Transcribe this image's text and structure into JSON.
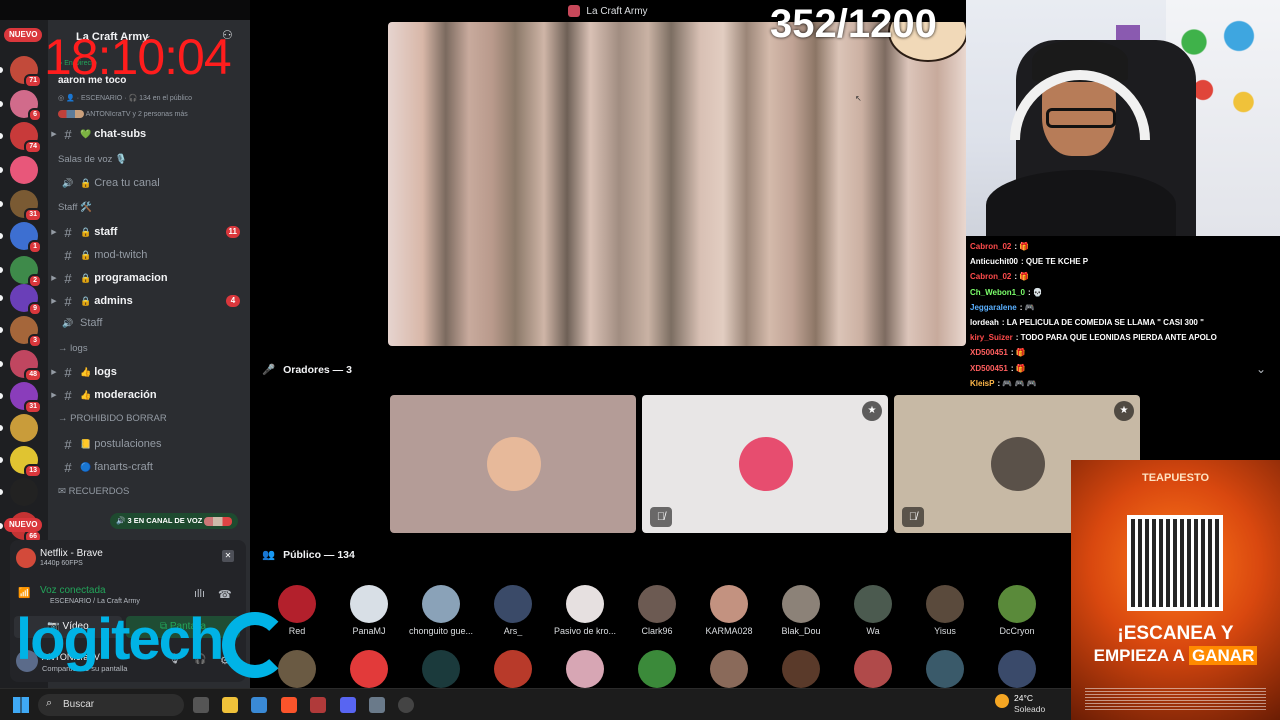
{
  "window": {
    "title": "La Craft Army"
  },
  "stream": {
    "timer": "18:10:04",
    "counter": "352/1200"
  },
  "rail": {
    "nuevo_top": "NUEVO",
    "nuevo_bottom": "NUEVO",
    "servers": [
      {
        "badge": "71",
        "color": "#c24a3a"
      },
      {
        "badge": "6",
        "color": "#d16b8b"
      },
      {
        "badge": "74",
        "color": "#c83a3a"
      },
      {
        "badge": "",
        "color": "#e8577a"
      },
      {
        "badge": "31",
        "color": "#7a5a33"
      },
      {
        "badge": "1",
        "color": "#3d6fd1"
      },
      {
        "badge": "2",
        "color": "#3e8a4a"
      },
      {
        "badge": "9",
        "color": "#6a3fb8"
      },
      {
        "badge": "3",
        "color": "#a5663a"
      },
      {
        "badge": "48",
        "color": "#c04660"
      },
      {
        "badge": "31",
        "color": "#8a3dbb"
      },
      {
        "badge": "",
        "color": "#c99c3a"
      },
      {
        "badge": "13",
        "color": "#e0c431"
      },
      {
        "badge": "",
        "color": "#222"
      },
      {
        "badge": "66",
        "color": "#c43333"
      }
    ]
  },
  "server": {
    "name": "La Craft Army",
    "live_label": "En Directo",
    "stage_title": "aaron me toco",
    "stage_meta": "ESCENARIO",
    "stage_listeners": "134 en el público",
    "stage_speakers": "ANTONIcraTV y 2 personas más"
  },
  "channels": [
    {
      "type": "text",
      "label": "chat-subs",
      "bold": true,
      "emoji": "💚",
      "caret": true
    },
    {
      "type": "category",
      "label": "Salas de voz 🎙️"
    },
    {
      "type": "voice",
      "label": "Crea tu canal",
      "lock": true
    },
    {
      "type": "category",
      "label": "Staff 🛠️"
    },
    {
      "type": "text",
      "label": "staff",
      "bold": true,
      "lock": true,
      "badge": "11",
      "caret": true
    },
    {
      "type": "text",
      "label": "mod-twitch",
      "lock": true
    },
    {
      "type": "text",
      "label": "programacion",
      "bold": true,
      "lock": true,
      "caret": true
    },
    {
      "type": "text",
      "label": "admins",
      "bold": true,
      "lock": true,
      "badge": "4",
      "caret": true
    },
    {
      "type": "voice",
      "label": "Staff",
      "lock": false
    },
    {
      "type": "category",
      "label": "→ logs"
    },
    {
      "type": "text",
      "label": "logs",
      "bold": true,
      "emoji": "👍",
      "caret": true
    },
    {
      "type": "text",
      "label": "moderación",
      "bold": true,
      "emoji": "👍",
      "caret": true
    },
    {
      "type": "category",
      "label": "→ PROHIBIDO BORRAR"
    },
    {
      "type": "text",
      "label": "postulaciones",
      "emoji": "📒"
    },
    {
      "type": "text",
      "label": "fanarts-craft",
      "emoji": "🔵"
    },
    {
      "type": "category",
      "label": "✉ RECUERDOS"
    }
  ],
  "voice_pill": "3 EN CANAL DE VOZ",
  "user_panel": {
    "activity_title": "Netflix - Brave",
    "activity_sub": "1440p 60FPS",
    "voice_status": "Voz conectada",
    "voice_channel": "ESCENARIO / La Craft Army",
    "video_btn": "Vídeo",
    "screen_btn": "Pantalla",
    "username": "ANTONIcraTV",
    "user_status": "Compartiendo su pantalla",
    "brand": "logitech"
  },
  "stage": {
    "speakers_header": "Oradores — 3",
    "audience_header": "Público — 134",
    "speakers": [
      {
        "bg": "#b49c97",
        "av": "#e7b99a"
      },
      {
        "bg": "#e8e6e6",
        "av": "#e74d6f"
      },
      {
        "bg": "#c7b9a5",
        "av": "#5a5149"
      }
    ],
    "audience_row1": [
      {
        "name": "Red",
        "color": "#b3202c"
      },
      {
        "name": "PanaMJ",
        "color": "#d8dfe6"
      },
      {
        "name": "chonguito gue...",
        "color": "#8aa2b8"
      },
      {
        "name": "Ars_",
        "color": "#3a4a68"
      },
      {
        "name": "Pasivo de kro...",
        "color": "#e6e0e0"
      },
      {
        "name": "Clark96",
        "color": "#6c5a52"
      },
      {
        "name": "KARMA028",
        "color": "#c39280"
      },
      {
        "name": "Blak_Dou",
        "color": "#8c8278"
      },
      {
        "name": "Wa",
        "color": "#4b5a4f"
      },
      {
        "name": "Yisus",
        "color": "#5a4a3c"
      },
      {
        "name": "DcCryon",
        "color": "#5a8a3a"
      }
    ],
    "audience_row2": [
      {
        "color": "#6a5a43"
      },
      {
        "color": "#e23a3a"
      },
      {
        "color": "#1b3a3c"
      },
      {
        "color": "#b83a2a"
      },
      {
        "color": "#d7a6b4"
      },
      {
        "color": "#3b8a3a"
      },
      {
        "color": "#8a6a5a"
      },
      {
        "color": "#5a3a2a"
      },
      {
        "color": "#b04a4a"
      },
      {
        "color": "#3a5a6a"
      },
      {
        "color": "#3a4a6a"
      }
    ]
  },
  "chat": [
    {
      "user": "Cabron_02",
      "msg": ": 🎁",
      "color": "#ff4b4b"
    },
    {
      "user": "Anticuchit00",
      "msg": ": QUE TE KCHE P",
      "color": "#ffffff"
    },
    {
      "user": "Cabron_02",
      "msg": ": 🎁",
      "color": "#ff4b4b"
    },
    {
      "user": "Ch_Webon1_0",
      "msg": ": 💀",
      "color": "#7cff6b"
    },
    {
      "user": "Jeggaralene",
      "msg": ": 🎮",
      "color": "#5ab0ff"
    },
    {
      "user": "lordeah",
      "msg": ": LA PELICULA DE COMEDIA SE LLAMA \" CASI 300 \"",
      "color": "#ffffff"
    },
    {
      "user": "kiry_Suizer",
      "msg": ": TODO PARA QUE LEONIDAS PIERDA ANTE APOLO",
      "color": "#ff4b4b"
    },
    {
      "user": "XD500451",
      "msg": ": 🎁",
      "color": "#ff5f5f"
    },
    {
      "user": "XD500451",
      "msg": ": 🎁",
      "color": "#ff5f5f"
    },
    {
      "user": "KleisP",
      "msg": ": 🎮 🎮 🎮",
      "color": "#ffb84a"
    }
  ],
  "ad": {
    "brand": "TEAPUESTO",
    "line1": "¡ESCANEA Y",
    "line2a": "EMPIEZA A ",
    "line2b": "GANAR"
  },
  "taskbar": {
    "search_placeholder": "Buscar",
    "temp": "24°C",
    "weather": "Soleado"
  }
}
